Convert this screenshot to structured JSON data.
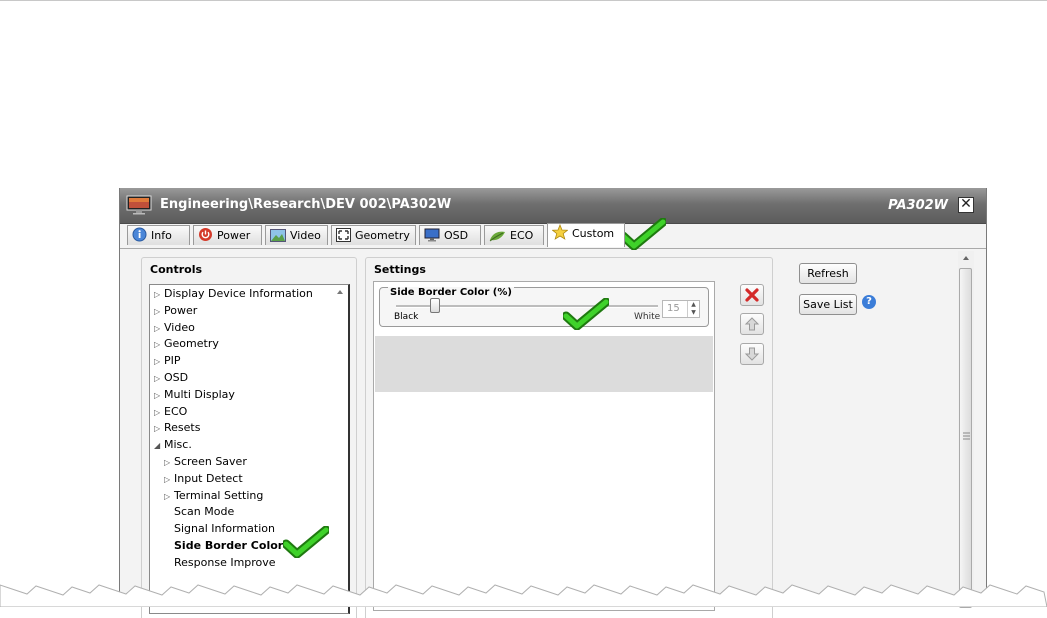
{
  "window": {
    "title": "Engineering\\Research\\DEV 002\\PA302W",
    "model": "PA302W",
    "close_glyph": "✕"
  },
  "tabs": [
    {
      "label": "Info",
      "icon": "info-icon"
    },
    {
      "label": "Power",
      "icon": "power-icon"
    },
    {
      "label": "Video",
      "icon": "video-icon"
    },
    {
      "label": "Geometry",
      "icon": "geometry-icon"
    },
    {
      "label": "OSD",
      "icon": "monitor-icon"
    },
    {
      "label": "ECO",
      "icon": "leaf-icon"
    },
    {
      "label": "Custom",
      "icon": "star-icon",
      "active": true
    }
  ],
  "controls": {
    "heading": "Controls",
    "items": [
      {
        "label": "Display Device Information",
        "expander": "▷"
      },
      {
        "label": "Power",
        "expander": "▷"
      },
      {
        "label": "Video",
        "expander": "▷"
      },
      {
        "label": "Geometry",
        "expander": "▷"
      },
      {
        "label": "PIP",
        "expander": "▷"
      },
      {
        "label": "OSD",
        "expander": "▷"
      },
      {
        "label": "Multi Display",
        "expander": "▷"
      },
      {
        "label": "ECO",
        "expander": "▷"
      },
      {
        "label": "Resets",
        "expander": "▷"
      },
      {
        "label": "Misc.",
        "expander": "◢"
      },
      {
        "label": "Screen Saver",
        "expander": "▷"
      },
      {
        "label": "Input Detect",
        "expander": "▷"
      },
      {
        "label": "Terminal Setting",
        "expander": "▷"
      },
      {
        "label": "Scan Mode",
        "expander": ""
      },
      {
        "label": "Signal Information",
        "expander": ""
      },
      {
        "label": "Side Border Color",
        "expander": "",
        "selected": true
      },
      {
        "label": "Response Improve",
        "expander": ""
      }
    ]
  },
  "settings": {
    "heading": "Settings",
    "item": {
      "title": "Side Border Color (%)",
      "min_label": "Black",
      "max_label": "White",
      "value": "15",
      "slider_fraction": 0.15
    }
  },
  "buttons": {
    "refresh": "Refresh",
    "save_list": "Save List",
    "help": "?"
  },
  "colors": {
    "accent_check": "#2ecc1a",
    "delete_red": "#d42a2a",
    "titlebar": "#6f6f6f"
  }
}
